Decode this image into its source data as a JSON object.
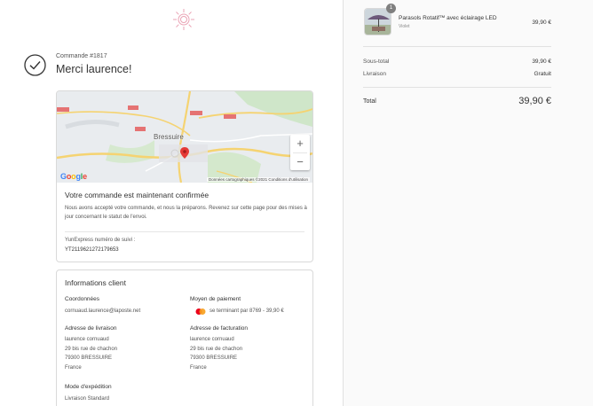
{
  "header": {
    "logo_icon": "sun-logo-icon"
  },
  "order": {
    "number": "Commande #1817",
    "thanks": "Merci laurence!"
  },
  "map": {
    "city": "Bressuire",
    "road_labels": [
      "D38",
      "N149",
      "D748",
      "N249",
      "D938TER",
      "N149",
      "D135"
    ],
    "copyright": "Données cartographiques ©2021   Conditions d'utilisation",
    "google_label": "Google",
    "zoom_in": "+",
    "zoom_out": "−"
  },
  "confirmation": {
    "title": "Votre commande est maintenant confirmée",
    "text": "Nous avons accepté votre commande, et nous la préparons. Revenez sur cette page pour des mises à jour concernant le statut de l'envoi.",
    "tracking_label": "YunExpress numéro de suivi :",
    "tracking_number": "YT2119621272179653"
  },
  "customer": {
    "title": "Informations client",
    "contact_heading": "Coordonnées",
    "email": "cornuaud.laurence@laposte.net",
    "payment_heading": "Moyen de paiement",
    "payment_text": "se terminant par 8769 - 39,90 €",
    "shipping_heading": "Adresse de livraison",
    "shipping_address": [
      "laurence cornuaud",
      "29 bis rue de chachon",
      "79300 BRESSUIRE",
      "France"
    ],
    "billing_heading": "Adresse de facturation",
    "billing_address": [
      "laurence cornuaud",
      "29 bis rue de chachon",
      "79300 BRESSUIRE",
      "France"
    ],
    "method_heading": "Mode d'expédition",
    "method": "Livraison Standard"
  },
  "cart": {
    "quantity": "1",
    "product_name": "Parasols Rotatif™ avec éclairage LED",
    "product_variant": "Violet",
    "product_price": "39,90 €"
  },
  "summary": {
    "subtotal_label": "Sous-total",
    "subtotal_value": "39,90 €",
    "shipping_label": "Livraison",
    "shipping_value": "Gratuit",
    "total_label": "Total",
    "total_value": "39,90 €"
  },
  "colors": {
    "accent": "#e8a0b0",
    "map_pin": "#e53935",
    "road": "#f7d56b"
  }
}
